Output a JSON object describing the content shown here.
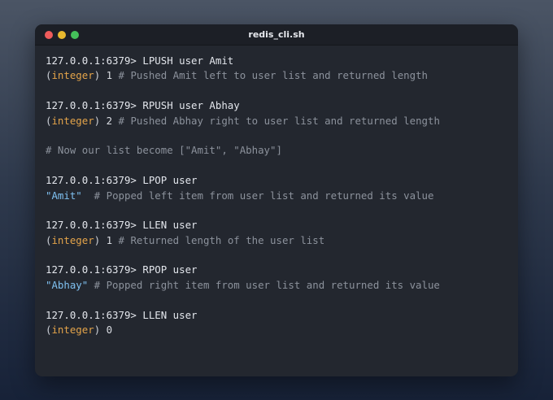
{
  "window": {
    "title": "redis_cli.sh",
    "dots": [
      {
        "name": "close",
        "color": "#ee5b5b"
      },
      {
        "name": "minimize",
        "color": "#e8b92e"
      },
      {
        "name": "maximize",
        "color": "#44c05a"
      }
    ]
  },
  "terminal": {
    "lines": [
      {
        "kind": "command",
        "text": "127.0.0.1:6379> LPUSH user Amit"
      },
      {
        "kind": "result",
        "open": "(",
        "type": "integer",
        "close": ")",
        "value": " 1",
        "comment": " # Pushed Amit left to user list and returned length"
      },
      {
        "kind": "blank"
      },
      {
        "kind": "command",
        "text": "127.0.0.1:6379> RPUSH user Abhay"
      },
      {
        "kind": "result",
        "open": "(",
        "type": "integer",
        "close": ")",
        "value": " 2",
        "comment": " # Pushed Abhay right to user list and returned length"
      },
      {
        "kind": "blank"
      },
      {
        "kind": "comment",
        "text": "# Now our list become [\"Amit\", \"Abhay\"]"
      },
      {
        "kind": "blank"
      },
      {
        "kind": "command",
        "text": "127.0.0.1:6379> LPOP user"
      },
      {
        "kind": "string",
        "value": "\"Amit\"",
        "comment": "  # Popped left item from user list and returned its value"
      },
      {
        "kind": "blank"
      },
      {
        "kind": "command",
        "text": "127.0.0.1:6379> LLEN user"
      },
      {
        "kind": "result",
        "open": "(",
        "type": "integer",
        "close": ")",
        "value": " 1",
        "comment": " # Returned length of the user list"
      },
      {
        "kind": "blank"
      },
      {
        "kind": "command",
        "text": "127.0.0.1:6379> RPOP user"
      },
      {
        "kind": "string",
        "value": "\"Abhay\"",
        "comment": " # Popped right item from user list and returned its value"
      },
      {
        "kind": "blank"
      },
      {
        "kind": "command",
        "text": "127.0.0.1:6379> LLEN user"
      },
      {
        "kind": "result",
        "open": "(",
        "type": "integer",
        "close": ")",
        "value": " 0",
        "comment": ""
      }
    ]
  }
}
